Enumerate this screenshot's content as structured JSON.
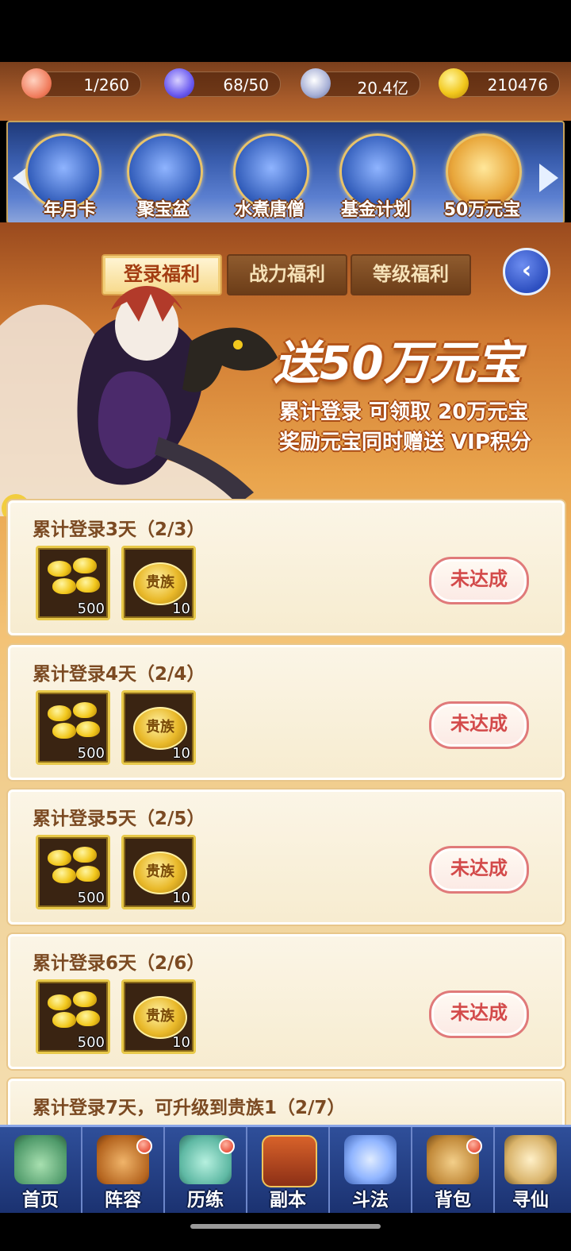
{
  "resources": [
    {
      "icon": "peach-icon",
      "value": "1/260",
      "color": "#f08a6a"
    },
    {
      "icon": "spirit-flame-icon",
      "value": "68/50",
      "color": "#6a6af0"
    },
    {
      "icon": "copper-coin-icon",
      "value": "20.4亿",
      "color": "#9aa4c8"
    },
    {
      "icon": "gold-ingot-icon",
      "value": "210476",
      "color": "#f2c81d"
    }
  ],
  "carousel": {
    "items": [
      {
        "label": "年月卡",
        "icon": "month-card-icon"
      },
      {
        "label": "聚宝盆",
        "icon": "treasure-bowl-icon"
      },
      {
        "label": "水煮唐僧",
        "icon": "monk-icon"
      },
      {
        "label": "基金计划",
        "icon": "fund-plan-icon"
      },
      {
        "label": "50万元宝",
        "icon": "treasure-chest-icon"
      }
    ]
  },
  "tabs": [
    {
      "label": "登录福利",
      "active": true
    },
    {
      "label": "战力福利",
      "active": false
    },
    {
      "label": "等级福利",
      "active": false
    }
  ],
  "promo": {
    "title": "送50万元宝",
    "line1": "累计登录 可领取 20万元宝",
    "line2": "奖励元宝同时赠送 VIP积分"
  },
  "tasks": [
    {
      "title": "累计登录3天（2/3）",
      "rewards": [
        {
          "name": "gold-ingot",
          "count": "500"
        },
        {
          "name": "noble",
          "label": "贵族",
          "count": "10"
        }
      ],
      "status": "未达成"
    },
    {
      "title": "累计登录4天（2/4）",
      "rewards": [
        {
          "name": "gold-ingot",
          "count": "500"
        },
        {
          "name": "noble",
          "label": "贵族",
          "count": "10"
        }
      ],
      "status": "未达成"
    },
    {
      "title": "累计登录5天（2/5）",
      "rewards": [
        {
          "name": "gold-ingot",
          "count": "500"
        },
        {
          "name": "noble",
          "label": "贵族",
          "count": "10"
        }
      ],
      "status": "未达成"
    },
    {
      "title": "累计登录6天（2/6）",
      "rewards": [
        {
          "name": "gold-ingot",
          "count": "500"
        },
        {
          "name": "noble",
          "label": "贵族",
          "count": "10"
        }
      ],
      "status": "未达成"
    },
    {
      "title": "累计登录7天，可升级到贵族1（2/7）"
    }
  ],
  "nav": [
    {
      "label": "首页",
      "icon": "home-icon",
      "badge": false,
      "color": "#6fbf8a"
    },
    {
      "label": "阵容",
      "icon": "lineup-icon",
      "badge": true,
      "color": "#c9773a"
    },
    {
      "label": "历练",
      "icon": "training-icon",
      "badge": true,
      "color": "#5fb9a4"
    },
    {
      "label": "副本",
      "icon": "dungeon-gate-icon",
      "badge": false,
      "color": "#c0582a"
    },
    {
      "label": "斗法",
      "icon": "battle-icon",
      "badge": false,
      "color": "#8fb4ff"
    },
    {
      "label": "背包",
      "icon": "bag-icon",
      "badge": true,
      "color": "#c28a3a"
    },
    {
      "label": "寻仙",
      "icon": "scroll-icon",
      "badge": false,
      "color": "#d9b36a"
    }
  ]
}
